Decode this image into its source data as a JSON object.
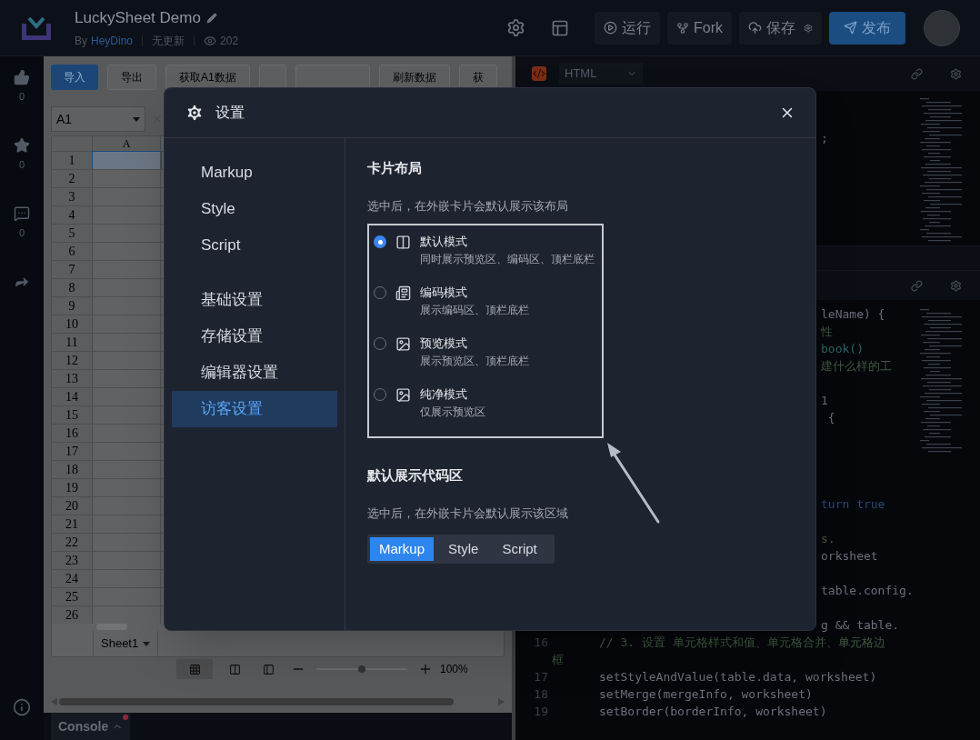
{
  "topbar": {
    "title": "LuckySheet Demo",
    "author_prefix": "By",
    "author": "HeyDino",
    "update_status": "无更新",
    "views": "202",
    "buttons": [
      {
        "label": "运行",
        "kind": "run"
      },
      {
        "label": "Fork",
        "kind": "fork"
      },
      {
        "label": "保存",
        "kind": "save"
      },
      {
        "label": "发布",
        "kind": "publish"
      }
    ]
  },
  "side_actions": [
    {
      "kind": "like",
      "count": "0"
    },
    {
      "kind": "star",
      "count": "0"
    },
    {
      "kind": "comment",
      "count": "0"
    },
    {
      "kind": "share"
    }
  ],
  "sheet": {
    "toolbar": [
      {
        "label": "导入",
        "primary": true
      },
      {
        "label": "导出",
        "primary": false
      },
      {
        "label": "获取A1数据",
        "primary": false
      },
      {
        "label": "刷新数据",
        "primary": false
      },
      {
        "label": "获",
        "primary": false
      }
    ],
    "name_box": "A1",
    "column": "A",
    "rows": [
      "1",
      "2",
      "3",
      "4",
      "5",
      "6",
      "7",
      "8",
      "9",
      "10",
      "11",
      "12",
      "13",
      "14",
      "15",
      "16",
      "17",
      "18",
      "19",
      "20",
      "21",
      "22",
      "23",
      "24",
      "25",
      "26"
    ],
    "sheet_tab": "Sheet1",
    "zoom": {
      "level": 0.5,
      "reading": "100%"
    }
  },
  "console": {
    "label": "Console",
    "unread": true
  },
  "editor_top": {
    "language": "HTML",
    "lines": [
      {
        "kind": "blank"
      },
      {
        "kind": "blank"
      },
      {
        "kind": "code",
        "text": ";"
      }
    ]
  },
  "editor_bottom": {
    "fragments": [
      {
        "kind": "code",
        "text": "leName) {"
      },
      {
        "kind": "comment",
        "text": "性"
      },
      {
        "kind": "function",
        "text": "book()"
      },
      {
        "kind": "comment",
        "text": "建什么样的工"
      },
      {
        "kind": "blank"
      },
      {
        "kind": "code",
        "text": "1"
      },
      {
        "kind": "code",
        "text": " {"
      },
      {
        "kind": "blank"
      },
      {
        "kind": "blank"
      },
      {
        "kind": "blank"
      },
      {
        "kind": "blank"
      },
      {
        "kind": "keyword",
        "text": "turn true"
      },
      {
        "kind": "blank"
      },
      {
        "kind": "comment",
        "text": "s."
      },
      {
        "kind": "code",
        "text": "orksheet"
      },
      {
        "kind": "blank"
      },
      {
        "kind": "code",
        "text": "table.config."
      },
      {
        "kind": "blank"
      },
      {
        "kind": "code",
        "text": "g && table."
      }
    ],
    "lines": [
      {
        "number": "16",
        "kind": "comment",
        "text": "// 3. 设置 单元格样式和值、单元格合并、单元格边"
      },
      {
        "kind": "comment",
        "text": "框"
      },
      {
        "number": "17",
        "kind": "code",
        "text": "setStyleAndValue(table.data, worksheet)"
      },
      {
        "number": "18",
        "kind": "code",
        "text": "setMerge(mergeInfo, worksheet)"
      },
      {
        "number": "19",
        "kind": "code",
        "text": "setBorder(borderInfo, worksheet)"
      }
    ]
  },
  "dialog": {
    "title": "设置",
    "nav_groups": [
      {
        "items": [
          {
            "label": "Markup",
            "selected": false
          },
          {
            "label": "Style",
            "selected": false
          },
          {
            "label": "Script",
            "selected": false
          }
        ]
      },
      {
        "items": [
          {
            "label": "基础设置",
            "selected": false
          },
          {
            "label": "存储设置",
            "selected": false
          },
          {
            "label": "编辑器设置",
            "selected": false
          },
          {
            "label": "访客设置",
            "selected": true
          }
        ]
      }
    ],
    "layout_section": {
      "title": "卡片布局",
      "description": "选中后，在外嵌卡片会默认展示该布局",
      "options": [
        {
          "kind": "split",
          "label": "默认模式",
          "detail": "同时展示预览区、编码区、顶栏底栏",
          "selected": true
        },
        {
          "kind": "code",
          "label": "编码模式",
          "detail": "展示编码区、顶栏底栏",
          "selected": false
        },
        {
          "kind": "image",
          "label": "预览模式",
          "detail": "展示预览区、顶栏底栏",
          "selected": false
        },
        {
          "kind": "image",
          "label": "纯净模式",
          "detail": "仅展示预览区",
          "selected": false
        }
      ]
    },
    "code_section": {
      "title": "默认展示代码区",
      "description": "选中后，在外嵌卡片会默认展示该区域",
      "tabs": [
        {
          "label": "Markup",
          "selected": true
        },
        {
          "label": "Style",
          "selected": false
        },
        {
          "label": "Script",
          "selected": false
        }
      ]
    }
  }
}
